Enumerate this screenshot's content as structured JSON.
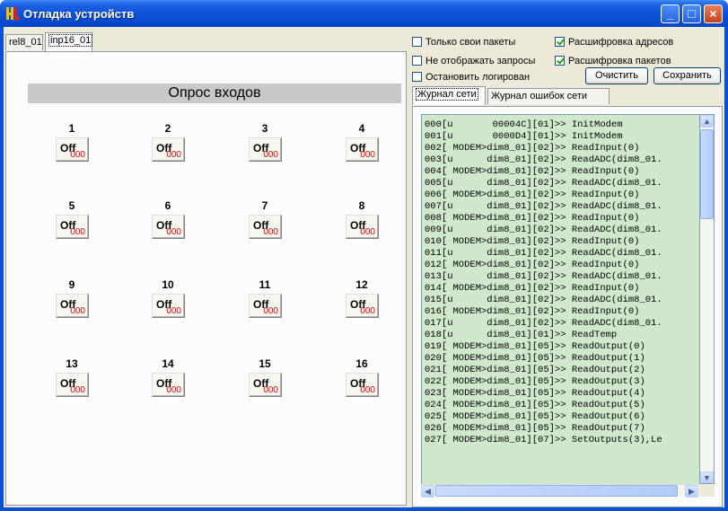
{
  "window": {
    "title": "Отладка устройств"
  },
  "left": {
    "tabs": [
      {
        "label": "rel8_01"
      },
      {
        "label": "inp16_01",
        "active": true
      }
    ],
    "poll_title": "Опрос входов",
    "inputs": [
      {
        "num": "1",
        "state": "Off",
        "value": "000"
      },
      {
        "num": "2",
        "state": "Off",
        "value": "000"
      },
      {
        "num": "3",
        "state": "Off",
        "value": "000"
      },
      {
        "num": "4",
        "state": "Off",
        "value": "000"
      },
      {
        "num": "5",
        "state": "Off",
        "value": "000"
      },
      {
        "num": "6",
        "state": "Off",
        "value": "000"
      },
      {
        "num": "7",
        "state": "Off",
        "value": "000"
      },
      {
        "num": "8",
        "state": "Off",
        "value": "000"
      },
      {
        "num": "9",
        "state": "Off",
        "value": "000"
      },
      {
        "num": "10",
        "state": "Off",
        "value": "000"
      },
      {
        "num": "11",
        "state": "Off",
        "value": "000"
      },
      {
        "num": "12",
        "state": "Off",
        "value": "000"
      },
      {
        "num": "13",
        "state": "Off",
        "value": "000"
      },
      {
        "num": "14",
        "state": "Off",
        "value": "000"
      },
      {
        "num": "15",
        "state": "Off",
        "value": "000"
      },
      {
        "num": "16",
        "state": "Off",
        "value": "000"
      }
    ]
  },
  "right": {
    "options": {
      "own_packets": {
        "label": "Только свои пакеты",
        "checked": false
      },
      "decode_addresses": {
        "label": "Расшифровка адресов",
        "checked": true
      },
      "hide_requests": {
        "label": "Не отображать запросы",
        "checked": false
      },
      "decode_packets": {
        "label": "Расшифровка пакетов",
        "checked": true
      },
      "stop_logging": {
        "label": "Остановить логирован",
        "checked": false
      }
    },
    "buttons": {
      "clear": "Очистить",
      "save": "Сохранить"
    },
    "tabs": [
      {
        "label": "Журнал сети",
        "active": true
      },
      {
        "label": "Журнал ошибок сети"
      }
    ],
    "log": [
      "000[u       00004C][01]>> InitModem",
      "001[u       0000D4][01]>> InitModem",
      "002[ MODEM>dim8_01][02]>> ReadInput(0)",
      "003[u      dim8_01][02]>> ReadADC(dim8_01.",
      "004[ MODEM>dim8_01][02]>> ReadInput(0)",
      "005[u      dim8_01][02]>> ReadADC(dim8_01.",
      "006[ MODEM>dim8_01][02]>> ReadInput(0)",
      "007[u      dim8_01][02]>> ReadADC(dim8_01.",
      "008[ MODEM>dim8_01][02]>> ReadInput(0)",
      "009[u      dim8_01][02]>> ReadADC(dim8_01.",
      "010[ MODEM>dim8_01][02]>> ReadInput(0)",
      "011[u      dim8_01][02]>> ReadADC(dim8_01.",
      "012[ MODEM>dim8_01][02]>> ReadInput(0)",
      "013[u      dim8_01][02]>> ReadADC(dim8_01.",
      "014[ MODEM>dim8_01][02]>> ReadInput(0)",
      "015[u      dim8_01][02]>> ReadADC(dim8_01.",
      "016[ MODEM>dim8_01][02]>> ReadInput(0)",
      "017[u      dim8_01][02]>> ReadADC(dim8_01.",
      "018[u      dim8_01][01]>> ReadTemp",
      "019[ MODEM>dim8_01][05]>> ReadOutput(0)",
      "020[ MODEM>dim8_01][05]>> ReadOutput(1)",
      "021[ MODEM>dim8_01][05]>> ReadOutput(2)",
      "022[ MODEM>dim8_01][05]>> ReadOutput(3)",
      "023[ MODEM>dim8_01][05]>> ReadOutput(4)",
      "024[ MODEM>dim8_01][05]>> ReadOutput(5)",
      "025[ MODEM>dim8_01][05]>> ReadOutput(6)",
      "026[ MODEM>dim8_01][05]>> ReadOutput(7)",
      "027[ MODEM>dim8_01][07]>> SetOutputs(3),Le"
    ]
  },
  "colors": {
    "log_bg": "#cfe8cc",
    "value_red": "#e00000",
    "titlebar": "#0a4fd6"
  }
}
